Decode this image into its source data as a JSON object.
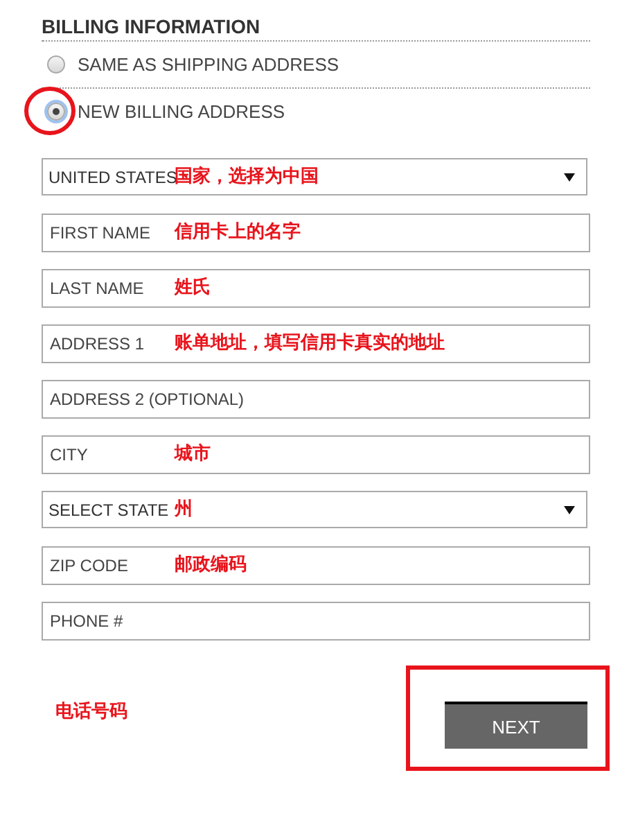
{
  "heading": "BILLING INFORMATION",
  "options": [
    {
      "label": "SAME AS SHIPPING ADDRESS",
      "selected": false,
      "highlighted": false
    },
    {
      "label": "NEW BILLING ADDRESS",
      "selected": true,
      "highlighted": true
    }
  ],
  "fields": [
    {
      "kind": "select",
      "value": "UNITED STATES",
      "annotation": "国家，选择为中国"
    },
    {
      "kind": "input",
      "placeholder": "FIRST NAME",
      "annotation": "信用卡上的名字"
    },
    {
      "kind": "input",
      "placeholder": "LAST NAME",
      "annotation": "姓氏"
    },
    {
      "kind": "input",
      "placeholder": "ADDRESS 1",
      "annotation": "账单地址，填写信用卡真实的地址"
    },
    {
      "kind": "input",
      "placeholder": "ADDRESS 2 (OPTIONAL)"
    },
    {
      "kind": "input",
      "placeholder": "CITY",
      "annotation": "城市"
    },
    {
      "kind": "select",
      "value": "SELECT STATE",
      "annotation": "州"
    },
    {
      "kind": "input",
      "placeholder": "ZIP CODE",
      "annotation": "邮政编码"
    },
    {
      "kind": "input",
      "placeholder": "PHONE #"
    }
  ],
  "phone_note": "电话号码",
  "next_button": {
    "label": "NEXT",
    "highlighted": true
  }
}
